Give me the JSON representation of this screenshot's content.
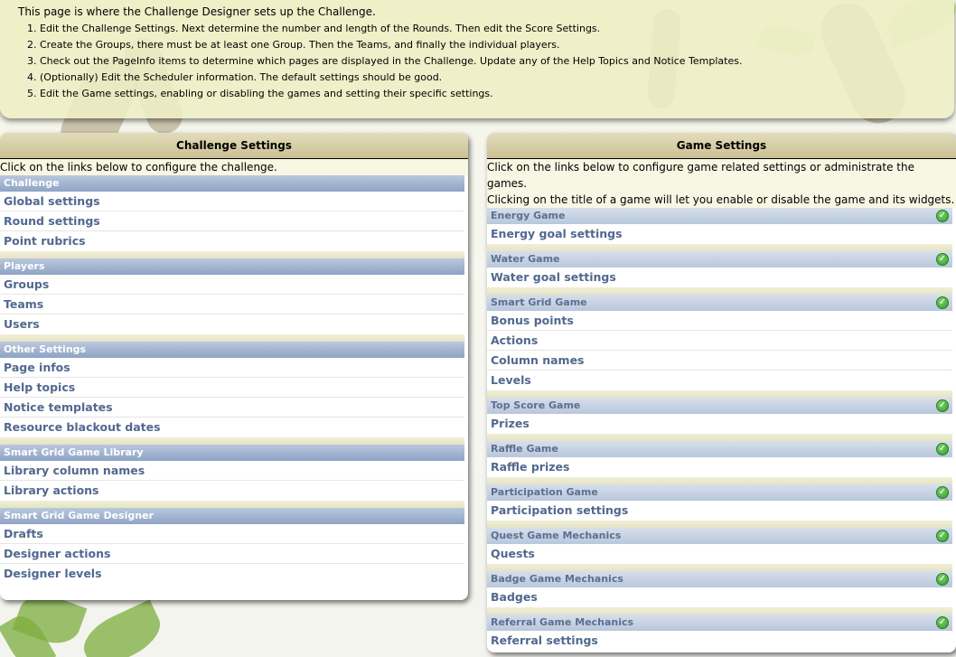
{
  "banner": {
    "intro": "This page is where the Challenge Designer sets up the Challenge.",
    "steps": [
      "Edit the Challenge Settings. Next determine the number and length of the Rounds. Then edit the Score Settings.",
      "Create the Groups, there must be at least one Group. Then the Teams, and finally the individual players.",
      "Check out the PageInfo items to determine which pages are displayed in the Challenge. Update any of the Help Topics and Notice Templates.",
      "(Optionally) Edit the Scheduler information. The default settings should be good.",
      "Edit the Game settings, enabling or disabling the games and setting their specific settings."
    ]
  },
  "challenge_panel": {
    "title": "Challenge Settings",
    "description": "Click on the links below to configure the challenge.",
    "sections": [
      {
        "heading": "Challenge",
        "links": [
          "Global settings",
          "Round settings",
          "Point rubrics"
        ]
      },
      {
        "heading": "Players",
        "links": [
          "Groups",
          "Teams",
          "Users"
        ]
      },
      {
        "heading": "Other Settings",
        "links": [
          "Page infos",
          "Help topics",
          "Notice templates",
          "Resource blackout dates"
        ]
      },
      {
        "heading": "Smart Grid Game Library",
        "links": [
          "Library column names",
          "Library actions"
        ]
      },
      {
        "heading": "Smart Grid Game Designer",
        "links": [
          "Drafts",
          "Designer actions",
          "Designer levels"
        ]
      }
    ]
  },
  "game_panel": {
    "title": "Game Settings",
    "description_line1": "Click on the links below to configure game related settings or administrate the games.",
    "description_line2": "Clicking on the title of a game will let you enable or disable the game and its widgets.",
    "status_icon": "check-circle-icon",
    "status_color": "#3aa52f",
    "sections": [
      {
        "heading": "Energy Game",
        "links": [
          "Energy goal settings"
        ]
      },
      {
        "heading": "Water Game",
        "links": [
          "Water goal settings"
        ]
      },
      {
        "heading": "Smart Grid Game",
        "links": [
          "Bonus points",
          "Actions",
          "Column names",
          "Levels"
        ]
      },
      {
        "heading": "Top Score Game",
        "links": [
          "Prizes"
        ]
      },
      {
        "heading": "Raffle Game",
        "links": [
          "Raffle prizes"
        ]
      },
      {
        "heading": "Participation Game",
        "links": [
          "Participation settings"
        ]
      },
      {
        "heading": "Quest Game Mechanics",
        "links": [
          "Quests"
        ]
      },
      {
        "heading": "Badge Game Mechanics",
        "links": [
          "Badges"
        ]
      },
      {
        "heading": "Referral Game Mechanics",
        "links": [
          "Referral settings"
        ]
      }
    ]
  }
}
